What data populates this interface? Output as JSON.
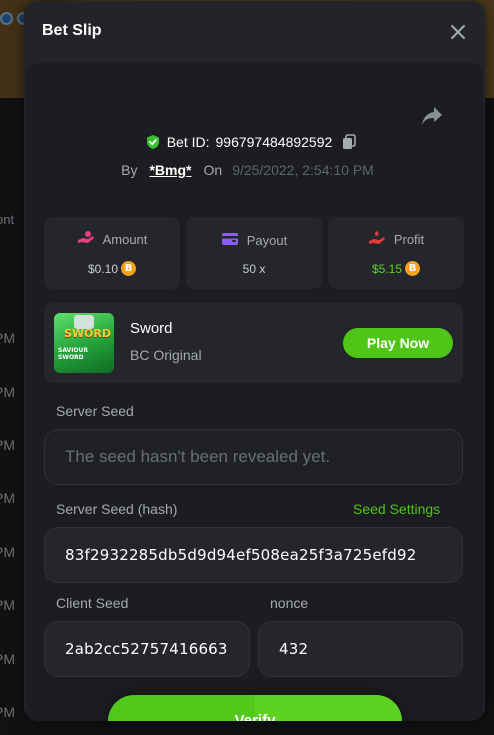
{
  "modal": {
    "title": "Bet Slip",
    "close_icon": "close-icon",
    "share_icon": "share-icon"
  },
  "bet": {
    "id_label": "Bet ID:",
    "id_value": "996797484892592",
    "by_label": "By",
    "user": "*Bmg*",
    "on_label": "On",
    "date": "9/25/2022, 2:54:10 PM"
  },
  "stats": [
    {
      "label": "Amount",
      "value": "$0.10",
      "icon": "money-hand-icon",
      "coin": "B"
    },
    {
      "label": "Payout",
      "value": "50 x",
      "icon": "wallet-icon",
      "coin": ""
    },
    {
      "label": "Profit",
      "value": "$5.15",
      "icon": "profit-hand-icon",
      "coin": "B"
    }
  ],
  "game": {
    "name": "Sword",
    "subtitle": "BC Original",
    "play_label": "Play Now",
    "thumb_title": "SWORD",
    "thumb_subtitle": "SAVIOUR SWORD"
  },
  "fields": {
    "server_seed_label": "Server Seed",
    "server_seed_placeholder": "The seed hasn't been revealed yet.",
    "server_hash_label": "Server Seed (hash)",
    "seed_settings_label": "Seed Settings",
    "server_hash_value": "83f2932285db5d9d94ef508ea25f3a725efd92",
    "client_seed_label": "Client Seed",
    "client_seed_value": "2ab2cc52757416663",
    "nonce_label": "nonce",
    "nonce_value": "432"
  },
  "verify": {
    "label": "Verify"
  },
  "background": {
    "times": [
      "PM",
      "PM",
      "PM",
      "PM",
      "PM",
      "PM",
      "PM",
      "PM"
    ],
    "cont": "ont"
  },
  "colors": {
    "accent_green": "#4fc518",
    "profit_green": "#5fd12a",
    "coin_orange": "#f4a21b",
    "panel": "#24262b"
  }
}
